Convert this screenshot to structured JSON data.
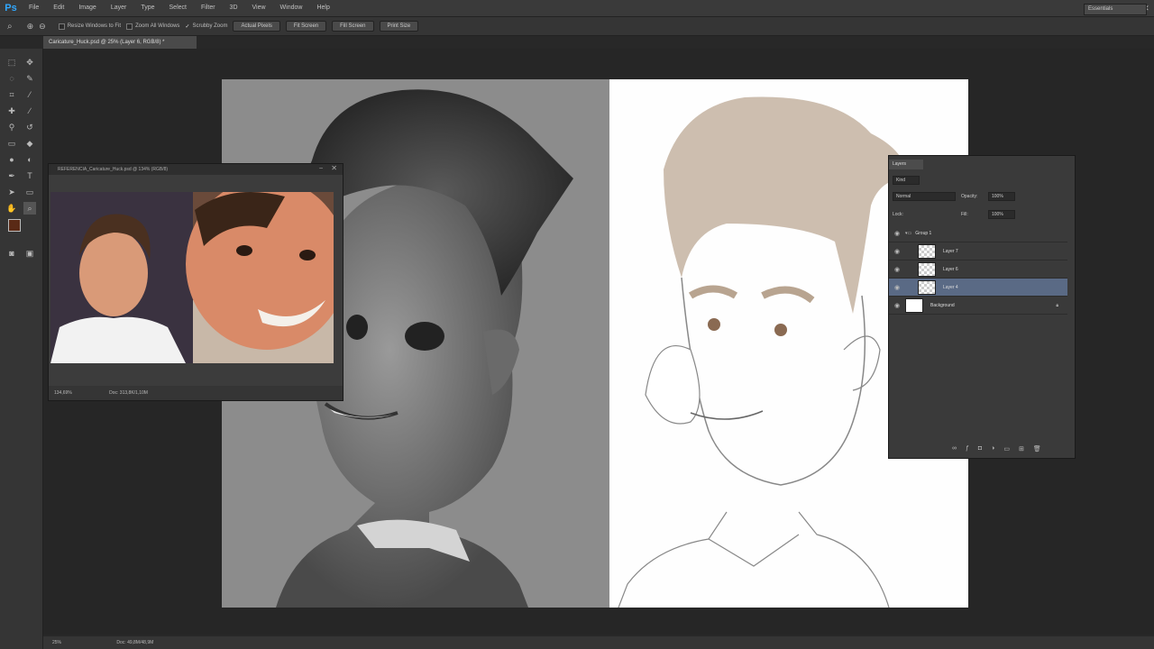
{
  "app": {
    "logo": "Ps"
  },
  "menu": [
    "File",
    "Edit",
    "Image",
    "Layer",
    "Type",
    "Select",
    "Filter",
    "3D",
    "View",
    "Window",
    "Help"
  ],
  "options": {
    "resize_windows": "Resize Windows to Fit",
    "zoom_all": "Zoom All Windows",
    "scrubby": "Scrubby Zoom",
    "buttons": [
      "Actual Pixels",
      "Fit Screen",
      "Fill Screen",
      "Print Size"
    ],
    "workspace": "Essentials"
  },
  "document": {
    "tab_label": "Caricature_Huck.psd @ 25% (Layer 6, RGB/8) *"
  },
  "reference": {
    "title": "REFERENCIA_Caricature_Huck.psd @ 134% (RGB/8)",
    "zoom": "134,69%",
    "doc_size": "Doc: 313,8K/1,10M"
  },
  "layers": {
    "tab": "Layers",
    "kind": "Kind",
    "blend_mode": "Normal",
    "opacity_label": "Opacity:",
    "opacity": "100%",
    "lock_label": "Lock:",
    "fill_label": "Fill:",
    "fill": "100%",
    "items": [
      {
        "name": "Group 1"
      },
      {
        "name": "Layer 7"
      },
      {
        "name": "Layer 6"
      },
      {
        "name": "Layer 4"
      },
      {
        "name": "Background"
      }
    ]
  },
  "status": {
    "zoom": "25%",
    "doc_size": "Doc: 49,8M/48,9M"
  }
}
